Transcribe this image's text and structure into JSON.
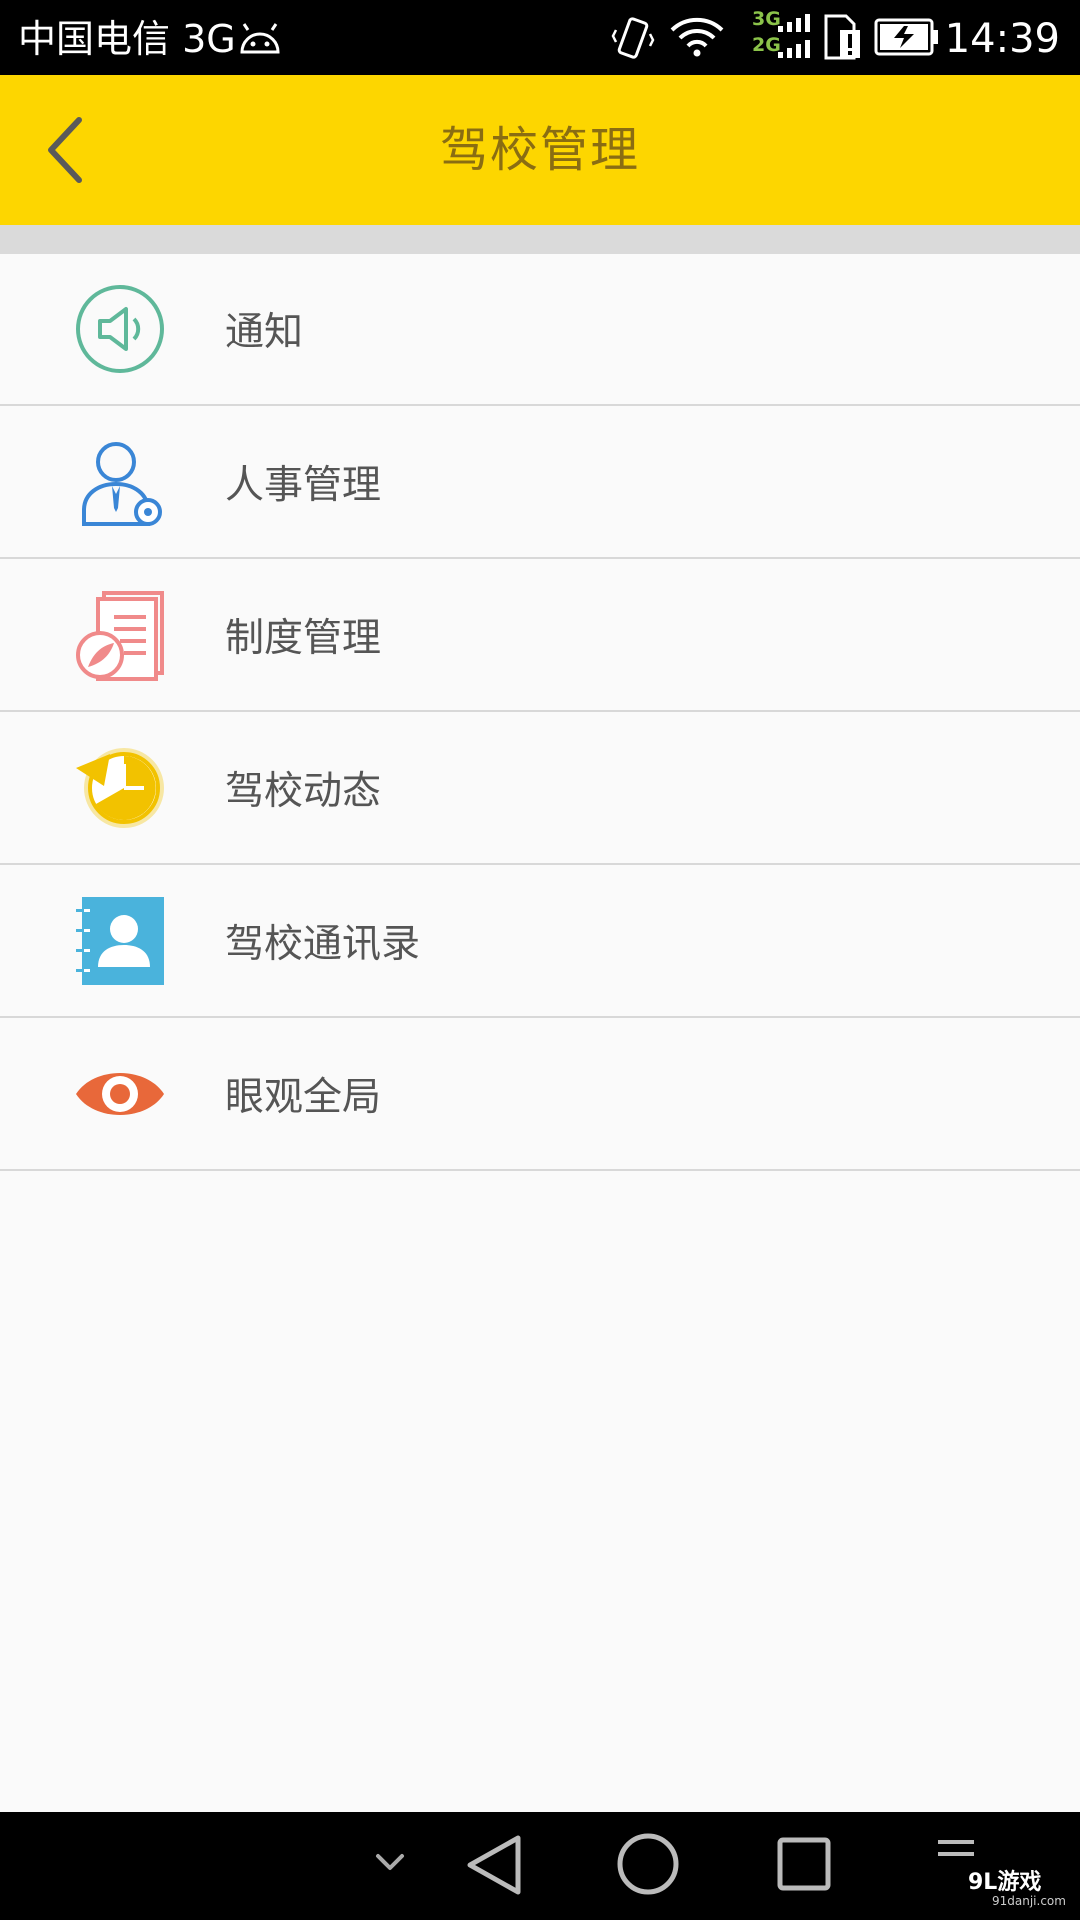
{
  "status_bar": {
    "carrier": "中国电信 3G",
    "network_3g": "3G",
    "network_2g": "2G",
    "time": "14:39",
    "icons": [
      "android-icon",
      "vibrate-icon",
      "wifi-icon",
      "signal-icon",
      "sim-icon",
      "battery-charging-icon"
    ]
  },
  "app_bar": {
    "title": "驾校管理",
    "back_icon": "chevron-left-icon",
    "background": "#fdd600",
    "title_color": "#8a6d12"
  },
  "menu": {
    "items": [
      {
        "label": "通知",
        "icon": "speaker-icon",
        "color": "#5fb89a"
      },
      {
        "label": "人事管理",
        "icon": "user-gear-icon",
        "color": "#3a86d6"
      },
      {
        "label": "制度管理",
        "icon": "document-icon",
        "color": "#f08a8a"
      },
      {
        "label": "驾校动态",
        "icon": "clock-icon",
        "color": "#f2c200"
      },
      {
        "label": "驾校通讯录",
        "icon": "contacts-book-icon",
        "color": "#4ab3dc"
      },
      {
        "label": "眼观全局",
        "icon": "eye-icon",
        "color": "#e8683a"
      }
    ]
  },
  "nav_bar": {
    "buttons": [
      "chevron-down-icon",
      "back-triangle-icon",
      "home-circle-icon",
      "recent-square-icon",
      "menu-lines-icon"
    ],
    "watermark": "9L游戏",
    "watermark_sub": "91danji.com"
  }
}
